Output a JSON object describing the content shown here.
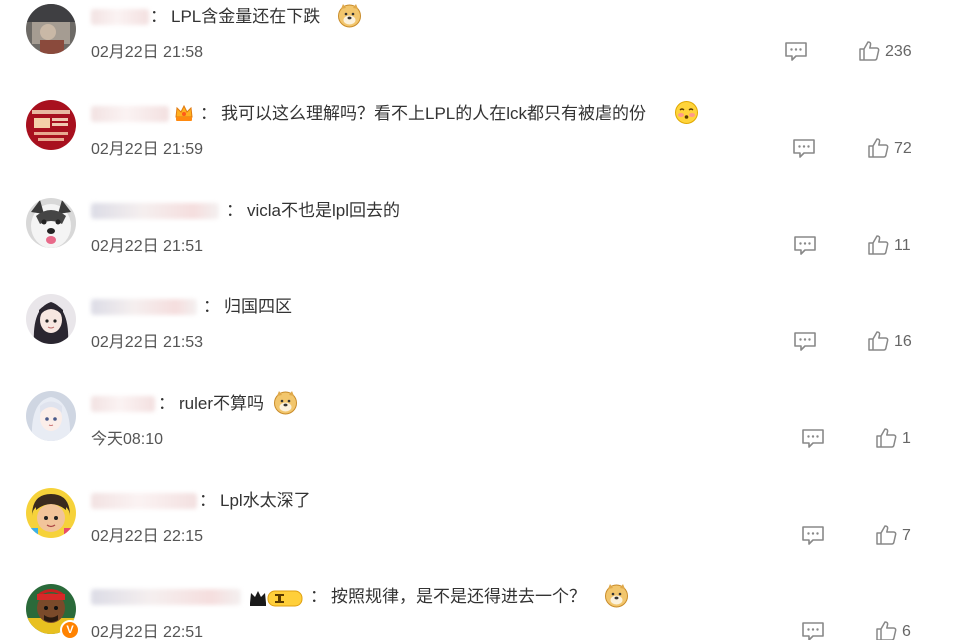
{
  "comments": [
    {
      "text": "LPL含金量还在下跌",
      "emoji_icon": "doge-emoji",
      "time": "02月22日 21:58",
      "likes": "236"
    },
    {
      "text": "我可以这么理解吗？看不上LPL的人在lck都只有被虐的份",
      "emoji_icon": "shy-face-emoji",
      "time": "02月22日 21:59",
      "likes": "72"
    },
    {
      "text": "vicla不也是lpl回去的",
      "time": "02月22日 21:51",
      "likes": "11"
    },
    {
      "text": "归国四区",
      "time": "02月22日 21:53",
      "likes": "16"
    },
    {
      "text": "ruler不算吗",
      "emoji_icon": "doge-emoji",
      "time": "今天08:10",
      "likes": "1"
    },
    {
      "text": "Lpl水太深了",
      "time": "02月22日 22:15",
      "likes": "7"
    },
    {
      "text": "按照规律，是不是还得进去一个？",
      "emoji_icon": "doge-emoji",
      "time": "02月22日 22:51",
      "likes": "6"
    }
  ],
  "colon": "：",
  "vip_badge": "V",
  "colors": {
    "text": "#333333",
    "meta": "#666666",
    "icon": "#888888",
    "vip_orange": "#ff8200"
  }
}
